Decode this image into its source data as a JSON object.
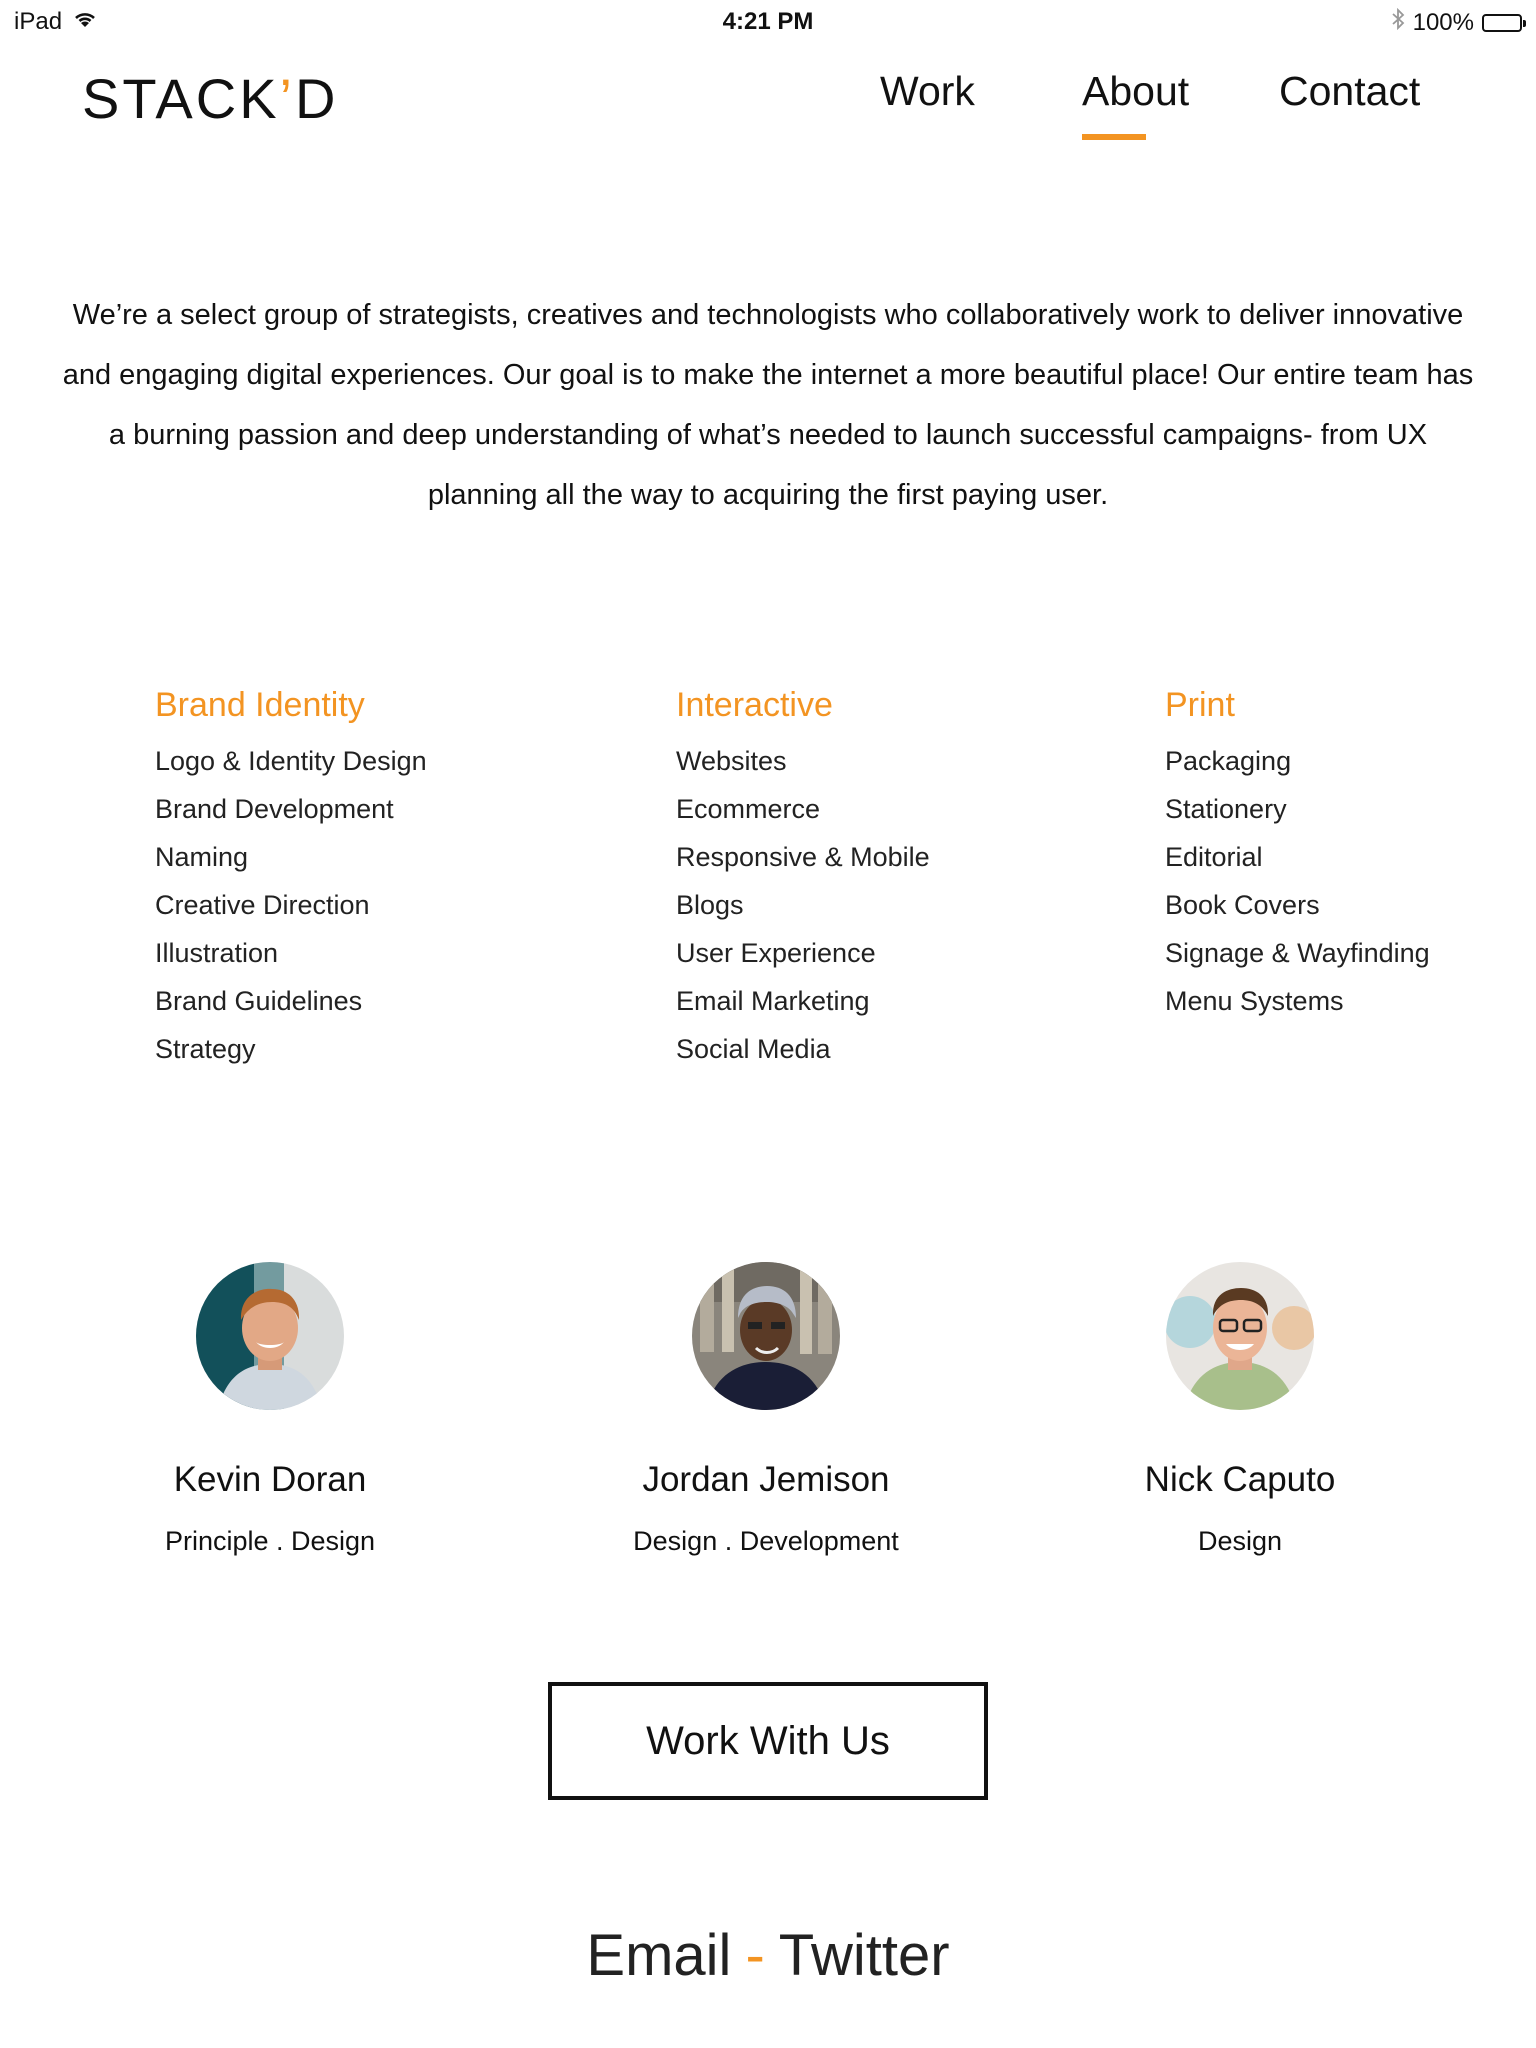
{
  "status_bar": {
    "device": "iPad",
    "time": "4:21 PM",
    "battery": "100%"
  },
  "header": {
    "logo_left": "STACK",
    "logo_apostrophe": "’",
    "logo_right": "D",
    "nav": [
      "Work",
      "About",
      "Contact"
    ],
    "active_nav": "About"
  },
  "intro": {
    "text": "We’re a select group of strategists, creatives and technologists who collaboratively work to deliver innovative and engaging digital experiences. Our goal is to make the internet a more beautiful place! Our entire team has a burning passion and deep understanding of what’s needed to launch successful campaigns- from UX planning all the way to acquiring the first paying user."
  },
  "services": [
    {
      "title": "Brand Identity",
      "items": [
        "Logo & Identity Design",
        "Brand Development",
        "Naming",
        "Creative Direction",
        "Illustration",
        "Brand Guidelines",
        "Strategy"
      ]
    },
    {
      "title": "Interactive",
      "items": [
        "Websites",
        "Ecommerce",
        "Responsive & Mobile",
        "Blogs",
        "User Experience",
        "Email Marketing",
        "Social Media"
      ]
    },
    {
      "title": "Print",
      "items": [
        "Packaging",
        "Stationery",
        "Editorial",
        "Book Covers",
        "Signage & Wayfinding",
        "Menu Systems"
      ]
    }
  ],
  "team": [
    {
      "name": "Kevin Doran",
      "role": "Principle . Design"
    },
    {
      "name": "Jordan Jemison",
      "role": "Design . Development"
    },
    {
      "name": "Nick Caputo",
      "role": "Design"
    }
  ],
  "cta": {
    "label": "Work With Us"
  },
  "footer": {
    "email_label": "Email",
    "separator": "-",
    "twitter_label": "Twitter"
  },
  "colors": {
    "accent": "#f39422",
    "text": "#111111",
    "background": "#ffffff"
  }
}
